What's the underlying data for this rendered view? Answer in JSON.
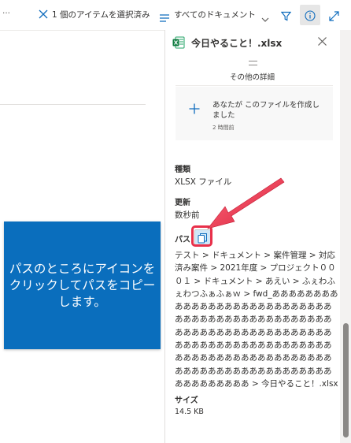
{
  "toolbar": {
    "more": "···",
    "selection_label": "1 個のアイテムを選択済み",
    "view_label": "すべてのドキュメント"
  },
  "callout": {
    "text": "パスのところにアイコンをクリックしてパスをコピーします。"
  },
  "details": {
    "file_name": "今日やること！.xlsx",
    "more_details": "その他の詳細",
    "activity": {
      "text": "あなたが このファイルを作成しました",
      "time": "2 時間前"
    },
    "type_label": "種類",
    "type_value": "XLSX ファイル",
    "modified_label": "更新",
    "modified_value": "数秒前",
    "path_label": "パス",
    "path_value": "テスト > ドキュメント > 案件管理 > 対応済み案件 > 2021年度 > プロジェクト０００１ > ドキュメント > あえい > ふぇわふぇわつふぁふぁｗ > fwd_あああああああああああああああああああああああああああああああああああああああああああああああああああああああああああああああああああああああああああああああああああああああああああああああああああああああああああああああああああああああああああああああああああ > 今日やること！.xlsx",
    "size_label": "サイズ",
    "size_value": "14.5 KB"
  },
  "colors": {
    "accent": "#0f6cbd",
    "callout_bg": "#0a6ebd",
    "arrow": "#e8304a",
    "excel_green": "#107c41"
  },
  "icons": {
    "close_selection": "close-icon",
    "view": "list-icon",
    "filter": "filter-icon",
    "info": "info-icon",
    "expand": "expand-icon",
    "file": "excel-file-icon",
    "copy": "copy-icon"
  }
}
